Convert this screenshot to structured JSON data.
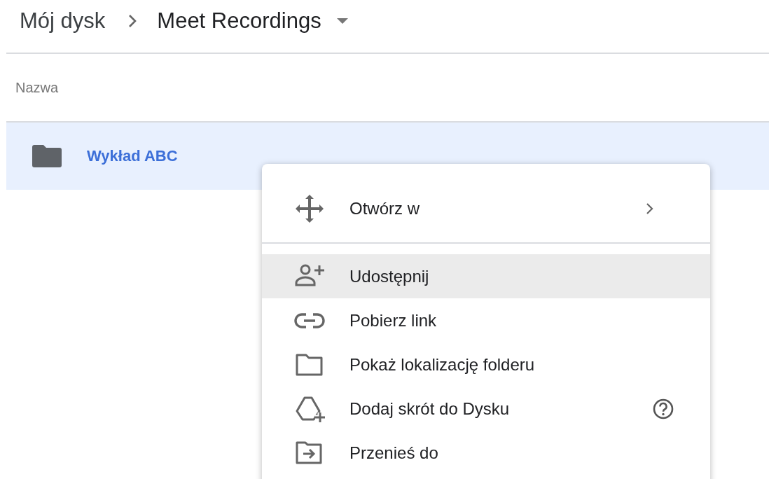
{
  "breadcrumb": [
    {
      "label": "Mój dysk",
      "current": false
    },
    {
      "label": "Meet Recordings",
      "current": true
    }
  ],
  "file_list": {
    "columns": [
      "Nazwa"
    ],
    "rows": [
      {
        "name": "Wykład ABC",
        "selected": true
      }
    ]
  },
  "context_menu": {
    "groups": [
      [
        {
          "label": "Otwórz w",
          "highlighted": false,
          "submenu": true,
          "help": false
        }
      ],
      [
        {
          "label": "Udostępnij",
          "highlighted": true,
          "submenu": false,
          "help": false
        },
        {
          "label": "Pobierz link",
          "highlighted": false,
          "submenu": false,
          "help": false
        },
        {
          "label": "Pokaż lokalizację folderu",
          "highlighted": false,
          "submenu": false,
          "help": false
        },
        {
          "label": "Dodaj skrót do Dysku",
          "highlighted": false,
          "submenu": false,
          "help": true
        },
        {
          "label": "Przenieś do",
          "highlighted": false,
          "submenu": false,
          "help": false
        }
      ]
    ]
  }
}
